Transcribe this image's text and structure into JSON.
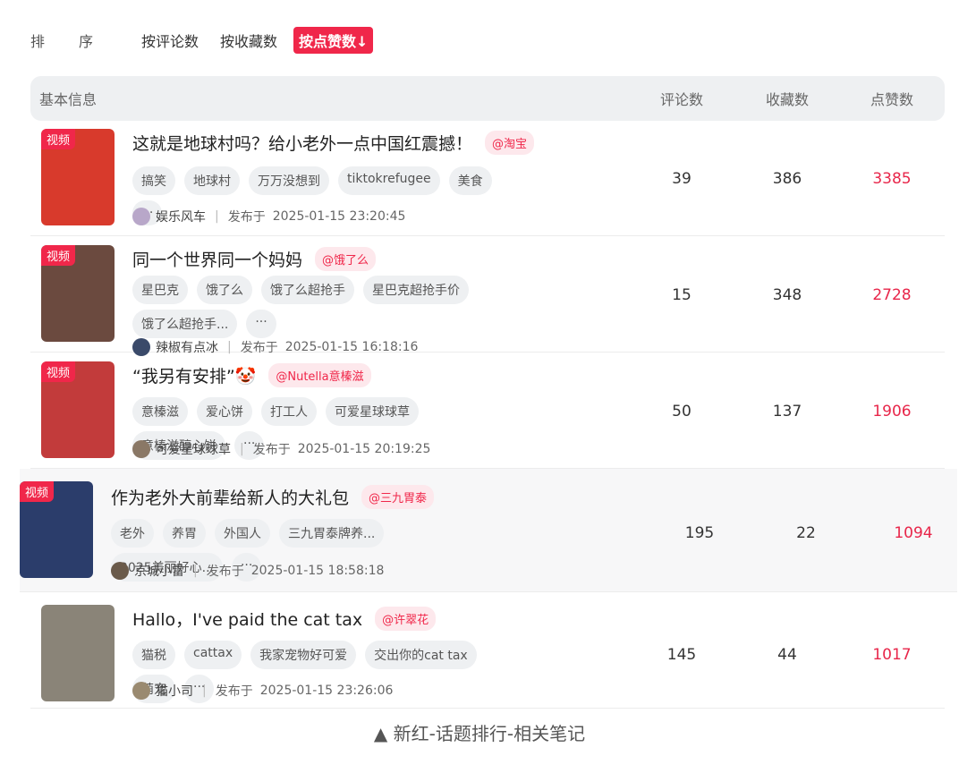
{
  "sort": {
    "label": "排序",
    "options": [
      "按评论数",
      "按收藏数",
      "按点赞数↓"
    ],
    "active_index": 2
  },
  "table": {
    "headers": {
      "info": "基本信息",
      "comments": "评论数",
      "favorites": "收藏数",
      "likes": "点赞数"
    },
    "video_badge": "视频",
    "more_tag": "···",
    "published_prefix": "发布于",
    "rows": [
      {
        "title": "这就是地球村吗？给小老外一点中国红震撼！",
        "brand": "@淘宝",
        "tags": [
          "搞笑",
          "地球村",
          "万万没想到",
          "tiktokrefugee",
          "美食"
        ],
        "author": "娱乐风车",
        "published": "2025-01-15 23:20:45",
        "comments": "39",
        "favorites": "386",
        "likes": "3385",
        "thumb_color": "#d83a2c",
        "avatar_color": "#b8a7c9",
        "has_badge": true
      },
      {
        "title": "同一个世界同一个妈妈",
        "brand": "@饿了么",
        "tags": [
          "星巴克",
          "饿了么",
          "饿了么超抢手",
          "星巴克超抢手价",
          "饿了么超抢手..."
        ],
        "author": "辣椒有点冰",
        "published": "2025-01-15 16:18:16",
        "comments": "15",
        "favorites": "348",
        "likes": "2728",
        "thumb_color": "#6b4a3f",
        "avatar_color": "#3a4a6a",
        "has_badge": true
      },
      {
        "title": "“我另有安排”🤡",
        "brand": "@Nutella意榛滋",
        "tags": [
          "意榛滋",
          "爱心饼",
          "打工人",
          "可爱星球球草",
          "意榛滋醇心饼"
        ],
        "author": "可爱星球球草",
        "published": "2025-01-15 20:19:25",
        "comments": "50",
        "favorites": "137",
        "likes": "1906",
        "thumb_color": "#c23b3b",
        "avatar_color": "#8a7866",
        "has_badge": true
      },
      {
        "title": "作为老外大前辈给新人的大礼包",
        "brand": "@三九胃泰",
        "tags": [
          "老外",
          "养胃",
          "外国人",
          "三九胃泰牌养...",
          "2025美丽好心..."
        ],
        "author": "京城小雷",
        "published": "2025-01-15 18:58:18",
        "comments": "195",
        "favorites": "22",
        "likes": "1094",
        "thumb_color": "#2b3d6b",
        "avatar_color": "#6a5a4a",
        "has_badge": true
      },
      {
        "title": "Hallo，I've paid the cat tax",
        "brand": "@许翠花",
        "tags": [
          "猫税",
          "cattax",
          "我家宠物好可爱",
          "交出你的cat tax",
          "萌宠"
        ],
        "author": "猫小司",
        "published": "2025-01-15 23:26:06",
        "comments": "145",
        "favorites": "44",
        "likes": "1017",
        "thumb_color": "#8a8478",
        "avatar_color": "#9a8a70",
        "has_badge": false
      }
    ]
  },
  "caption": "▲ 新红-话题排行-相关笔记"
}
